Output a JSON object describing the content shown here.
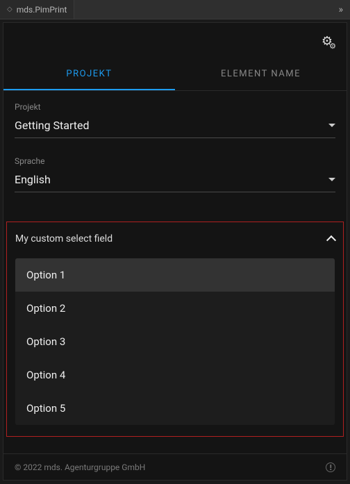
{
  "window": {
    "title": "mds.PimPrint"
  },
  "tabs": {
    "projekt": "PROJEKT",
    "elementName": "ELEMENT NAME"
  },
  "fields": {
    "projekt": {
      "label": "Projekt",
      "value": "Getting Started"
    },
    "sprache": {
      "label": "Sprache",
      "value": "English"
    }
  },
  "customSelect": {
    "label": "My custom select field",
    "options": [
      "Option 1",
      "Option 2",
      "Option 3",
      "Option 4",
      "Option 5"
    ],
    "selectedIndex": 0
  },
  "footer": {
    "copyright": "© 2022 mds. Agenturgruppe GmbH"
  }
}
